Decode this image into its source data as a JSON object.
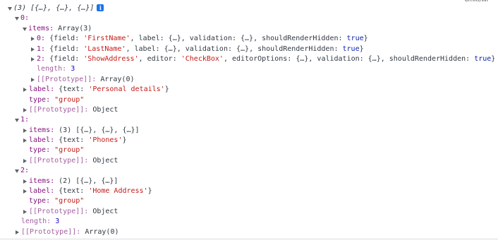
{
  "corner_tag": "cmkewi",
  "root": {
    "summary_count": "(3)",
    "summary_preview": "[{…}, {…}, {…}]",
    "info_icon": "i"
  },
  "items": [
    {
      "key": "0:",
      "items_key": "items:",
      "items_value": "Array(3)",
      "children": [
        {
          "index": "0:",
          "open": "{field: ",
          "field": "'FirstName'",
          "middle": ", label: {…}, validation: {…}, shouldRenderHidden: ",
          "bool": "true",
          "close": "}"
        },
        {
          "index": "1:",
          "open": "{field: ",
          "field": "'LastName'",
          "middle": ", label: {…}, validation: {…}, shouldRenderHidden: ",
          "bool": "true",
          "close": "}"
        },
        {
          "index": "2:",
          "open": "{field: ",
          "field": "'ShowAddress'",
          "middle": ", editor: ",
          "editor": "'CheckBox'",
          "middle2": ", editorOptions: {…}, validation: {…}, shouldRenderHidden: ",
          "bool": "true",
          "close": "}"
        }
      ],
      "length_key": "length:",
      "length_value": "3",
      "inner_proto_key": "[[Prototype]]:",
      "inner_proto_value": "Array(0)",
      "label_key": "label:",
      "label_open": "{text: ",
      "label_text": "'Personal details'",
      "label_close": "}",
      "type_key": "type:",
      "type_value": "\"group\"",
      "proto_key": "[[Prototype]]:",
      "proto_value": "Object"
    },
    {
      "key": "1:",
      "items_key": "items:",
      "items_count": "(3)",
      "items_preview": "[{…}, {…}, {…}]",
      "label_key": "label:",
      "label_open": "{text: ",
      "label_text": "'Phones'",
      "label_close": "}",
      "type_key": "type:",
      "type_value": "\"group\"",
      "proto_key": "[[Prototype]]:",
      "proto_value": "Object"
    },
    {
      "key": "2:",
      "items_key": "items:",
      "items_count": "(2)",
      "items_preview": "[{…}, {…}]",
      "label_key": "label:",
      "label_open": "{text: ",
      "label_text": "'Home Address'",
      "label_close": "}",
      "type_key": "type:",
      "type_value": "\"group\"",
      "proto_key": "[[Prototype]]:",
      "proto_value": "Object"
    }
  ],
  "length_key": "length:",
  "length_value": "3",
  "proto_key": "[[Prototype]]:",
  "proto_value": "Array(0)"
}
